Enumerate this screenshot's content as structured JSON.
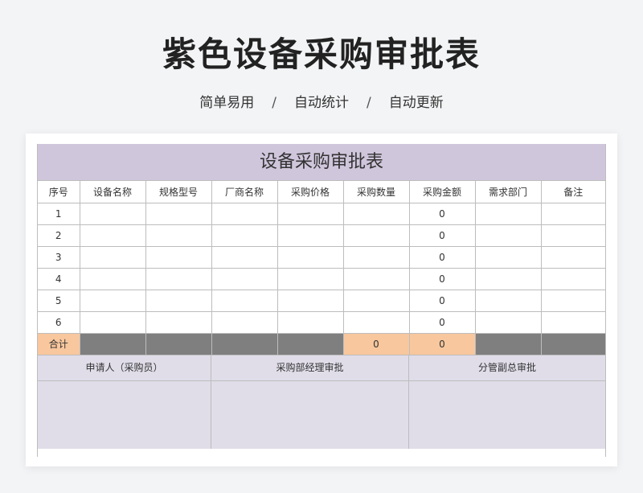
{
  "header": {
    "title": "紫色设备采购审批表",
    "features": [
      "简单易用",
      "自动统计",
      "自动更新"
    ],
    "separator": "/"
  },
  "sheet": {
    "title": "设备采购审批表",
    "columns": [
      "序号",
      "设备名称",
      "规格型号",
      "厂商名称",
      "采购价格",
      "采购数量",
      "采购金额",
      "需求部门",
      "备注"
    ],
    "rows": [
      [
        "1",
        "",
        "",
        "",
        "",
        "",
        "0",
        "",
        ""
      ],
      [
        "2",
        "",
        "",
        "",
        "",
        "",
        "0",
        "",
        ""
      ],
      [
        "3",
        "",
        "",
        "",
        "",
        "",
        "0",
        "",
        ""
      ],
      [
        "4",
        "",
        "",
        "",
        "",
        "",
        "0",
        "",
        ""
      ],
      [
        "5",
        "",
        "",
        "",
        "",
        "",
        "0",
        "",
        ""
      ],
      [
        "6",
        "",
        "",
        "",
        "",
        "",
        "0",
        "",
        ""
      ]
    ],
    "total": {
      "label": "合计",
      "quantity": "0",
      "amount": "0"
    },
    "approvals": [
      "申请人（采购员）",
      "采购部经理审批",
      "分管副总审批"
    ]
  },
  "colors": {
    "title_band": "#d0c6dc",
    "approval_band": "#e0dde9",
    "total_highlight": "#f8c79d",
    "total_blank": "#7f7f7f"
  }
}
